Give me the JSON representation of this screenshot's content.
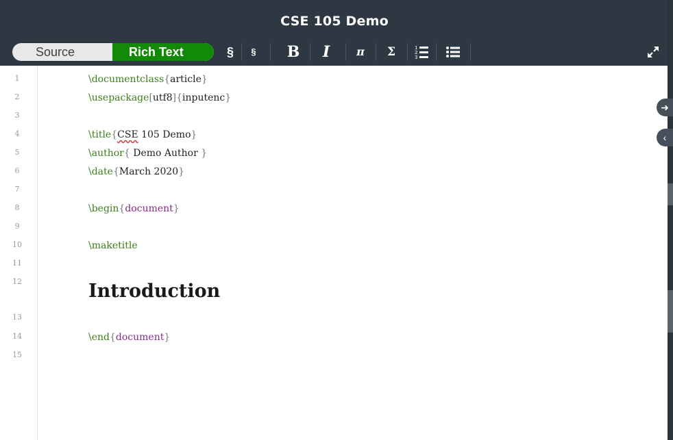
{
  "window": {
    "title": "CSE 105 Demo"
  },
  "toolbar": {
    "source_label": "Source",
    "rich_text_label": "Rich Text",
    "section_label": "§",
    "subsection_label": "§",
    "bold_label": "B",
    "italic_label": "I",
    "math_inline_label": "π",
    "math_display_label": "Σ",
    "numbered_list_label": "numbered-list-icon",
    "bullet_list_label": "bullet-list-icon",
    "expand_label": "expand-icon"
  },
  "editor": {
    "line_numbers": [
      "1",
      "2",
      "3",
      "4",
      "5",
      "6",
      "7",
      "8",
      "9",
      "10",
      "11",
      "12",
      "13",
      "14",
      "15"
    ],
    "lines": {
      "l1_cmd": "\\documentclass",
      "l1_arg": "article",
      "l2_cmd": "\\usepackage",
      "l2_opt": "utf8",
      "l2_arg": "inputenc",
      "l4_cmd": "\\title",
      "l4_arg_a": "CSE",
      "l4_arg_b": " 105 Demo",
      "l5_cmd": "\\author",
      "l5_arg": " Demo Author ",
      "l6_cmd": "\\date",
      "l6_arg": "March 2020",
      "l8_cmd": "\\begin",
      "l8_env": "document",
      "l10_cmd": "\\maketitle",
      "l12_heading": "Introduction",
      "l14_cmd": "\\end",
      "l14_env": "document"
    }
  },
  "colors": {
    "titlebar": "#2e3842",
    "rich_text_active": "#138a07",
    "command": "#3a7f1a",
    "environment": "#8a2b8a"
  }
}
